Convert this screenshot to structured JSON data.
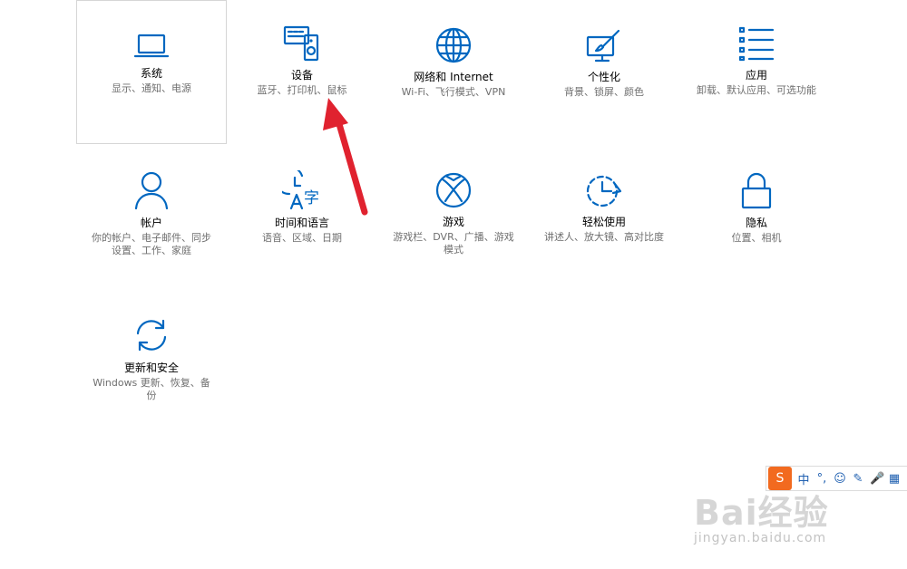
{
  "tiles": [
    {
      "name": "系统",
      "desc": "显示、通知、电源",
      "icon": "laptop-icon"
    },
    {
      "name": "设备",
      "desc": "蓝牙、打印机、鼠标",
      "icon": "devices-icon"
    },
    {
      "name": "网络和 Internet",
      "desc": "Wi-Fi、飞行模式、VPN",
      "icon": "globe-icon"
    },
    {
      "name": "个性化",
      "desc": "背景、锁屏、颜色",
      "icon": "personalization-icon"
    },
    {
      "name": "应用",
      "desc": "卸载、默认应用、可选功能",
      "icon": "apps-list-icon"
    },
    {
      "name": "帐户",
      "desc": "你的帐户、电子邮件、同步设置、工作、家庭",
      "icon": "person-icon"
    },
    {
      "name": "时间和语言",
      "desc": "语音、区域、日期",
      "icon": "time-language-icon"
    },
    {
      "name": "游戏",
      "desc": "游戏栏、DVR、广播、游戏模式",
      "icon": "xbox-icon"
    },
    {
      "name": "轻松使用",
      "desc": "讲述人、放大镜、高对比度",
      "icon": "ease-of-access-icon"
    },
    {
      "name": "隐私",
      "desc": "位置、相机",
      "icon": "lock-icon"
    },
    {
      "name": "更新和安全",
      "desc": "Windows 更新、恢复、备份",
      "icon": "sync-icon"
    }
  ],
  "ime": {
    "mode": "中",
    "punct": "°,",
    "emoji": "☺",
    "pen": "✎",
    "mic": "🎤",
    "grid": "▦"
  },
  "watermark": {
    "brand": "Bai经验",
    "url": "jingyan.baidu.com"
  },
  "colors": {
    "accent": "#0067c0",
    "annotation_arrow": "#e0222f"
  }
}
